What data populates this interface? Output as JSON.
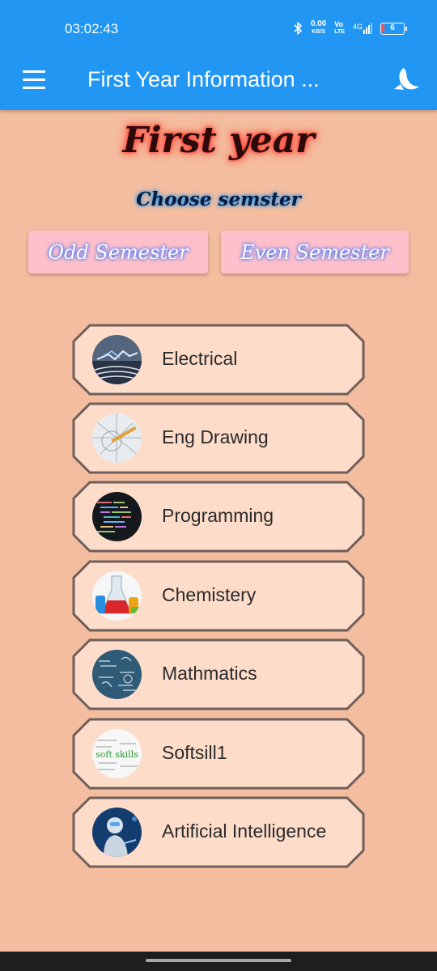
{
  "status_bar": {
    "time": "03:02:43",
    "net_speed_value": "0.00",
    "net_speed_unit": "KB/S",
    "volte_top": "Vo",
    "volte_bottom": "LTE",
    "network": "4G",
    "battery": "6"
  },
  "app_bar": {
    "title": "First Year Information ...",
    "menu_icon": "hamburger-menu-icon",
    "theme_icon": "dark-mode-moon-icon"
  },
  "header": {
    "title": "First year",
    "subtitle": "Choose semster"
  },
  "semesters": {
    "odd_label": "Odd Semester",
    "even_label": "Even Semester"
  },
  "subjects": [
    {
      "label": "Electrical",
      "icon": "lightning-icon"
    },
    {
      "label": "Eng Drawing",
      "icon": "drafting-icon"
    },
    {
      "label": "Programming",
      "icon": "code-icon"
    },
    {
      "label": "Chemistery",
      "icon": "flask-icon"
    },
    {
      "label": "Mathmatics",
      "icon": "formula-icon"
    },
    {
      "label": "Softsill1",
      "icon": "soft-skills-icon",
      "icon_text": "soft skills"
    },
    {
      "label": "Artificial Intelligence",
      "icon": "robot-icon"
    }
  ],
  "colors": {
    "app_bar": "#2196f3",
    "background": "#f4bd9f",
    "card": "#fddcc9",
    "card_border": "#6e5f5a",
    "semester_button": "#ffc0cb"
  }
}
